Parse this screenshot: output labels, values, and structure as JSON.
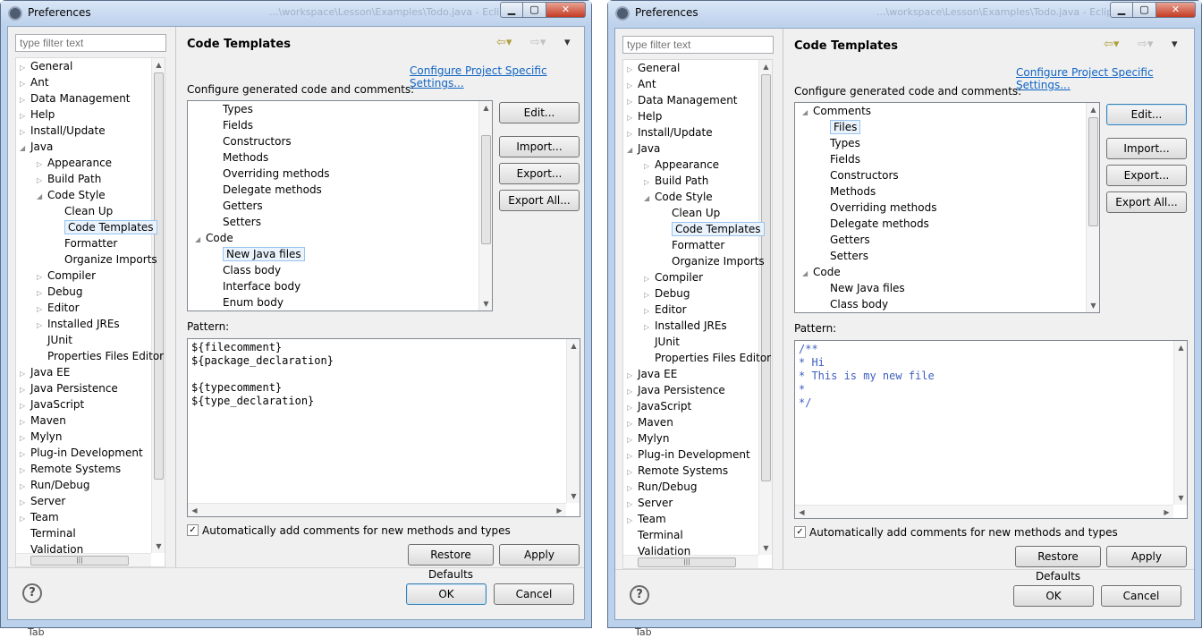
{
  "left": {
    "title": "Preferences",
    "ghost_title": "...\\workspace\\Lesson\\Examples\\Todo.java - Eclipse",
    "filter_placeholder": "type filter text",
    "tree": [
      {
        "label": "General",
        "level": 0,
        "exp": "closed"
      },
      {
        "label": "Ant",
        "level": 0,
        "exp": "closed"
      },
      {
        "label": "Data Management",
        "level": 0,
        "exp": "closed"
      },
      {
        "label": "Help",
        "level": 0,
        "exp": "closed"
      },
      {
        "label": "Install/Update",
        "level": 0,
        "exp": "closed"
      },
      {
        "label": "Java",
        "level": 0,
        "exp": "open"
      },
      {
        "label": "Appearance",
        "level": 1,
        "exp": "closed"
      },
      {
        "label": "Build Path",
        "level": 1,
        "exp": "closed"
      },
      {
        "label": "Code Style",
        "level": 1,
        "exp": "open"
      },
      {
        "label": "Clean Up",
        "level": 2,
        "exp": ""
      },
      {
        "label": "Code Templates",
        "level": 2,
        "exp": "",
        "selected": true
      },
      {
        "label": "Formatter",
        "level": 2,
        "exp": ""
      },
      {
        "label": "Organize Imports",
        "level": 2,
        "exp": ""
      },
      {
        "label": "Compiler",
        "level": 1,
        "exp": "closed"
      },
      {
        "label": "Debug",
        "level": 1,
        "exp": "closed"
      },
      {
        "label": "Editor",
        "level": 1,
        "exp": "closed"
      },
      {
        "label": "Installed JREs",
        "level": 1,
        "exp": "closed"
      },
      {
        "label": "JUnit",
        "level": 1,
        "exp": ""
      },
      {
        "label": "Properties Files Editor",
        "level": 1,
        "exp": ""
      },
      {
        "label": "Java EE",
        "level": 0,
        "exp": "closed"
      },
      {
        "label": "Java Persistence",
        "level": 0,
        "exp": "closed"
      },
      {
        "label": "JavaScript",
        "level": 0,
        "exp": "closed"
      },
      {
        "label": "Maven",
        "level": 0,
        "exp": "closed"
      },
      {
        "label": "Mylyn",
        "level": 0,
        "exp": "closed"
      },
      {
        "label": "Plug-in Development",
        "level": 0,
        "exp": "closed"
      },
      {
        "label": "Remote Systems",
        "level": 0,
        "exp": "closed"
      },
      {
        "label": "Run/Debug",
        "level": 0,
        "exp": "closed"
      },
      {
        "label": "Server",
        "level": 0,
        "exp": "closed"
      },
      {
        "label": "Team",
        "level": 0,
        "exp": "closed"
      },
      {
        "label": "Terminal",
        "level": 0,
        "exp": ""
      },
      {
        "label": "Validation",
        "level": 0,
        "exp": ""
      }
    ],
    "page_title": "Code Templates",
    "link": "Configure Project Specific Settings...",
    "description": "Configure generated code and comments:",
    "templates": [
      {
        "label": "Types",
        "level": 1
      },
      {
        "label": "Fields",
        "level": 1
      },
      {
        "label": "Constructors",
        "level": 1
      },
      {
        "label": "Methods",
        "level": 1
      },
      {
        "label": "Overriding methods",
        "level": 1
      },
      {
        "label": "Delegate methods",
        "level": 1
      },
      {
        "label": "Getters",
        "level": 1
      },
      {
        "label": "Setters",
        "level": 1
      },
      {
        "label": "Code",
        "level": 0,
        "exp": "open"
      },
      {
        "label": "New Java files",
        "level": 1,
        "selected": true
      },
      {
        "label": "Class body",
        "level": 1
      },
      {
        "label": "Interface body",
        "level": 1
      },
      {
        "label": "Enum body",
        "level": 1
      }
    ],
    "buttons": {
      "edit": "Edit...",
      "import": "Import...",
      "export": "Export...",
      "export_all": "Export All..."
    },
    "pattern_label": "Pattern:",
    "pattern": "${filecomment}\n${package_declaration}\n\n${typecomment}\n${type_declaration}",
    "auto_comments": "Automatically add comments for new methods and types",
    "restore": "Restore Defaults",
    "apply": "Apply",
    "ok": "OK",
    "cancel": "Cancel",
    "help": "?",
    "underneath": "Tab"
  },
  "right": {
    "title": "Preferences",
    "ghost_title": "...\\workspace\\Lesson\\Examples\\Todo.java - Eclipse",
    "filter_placeholder": "type filter text",
    "tree": [
      {
        "label": "General",
        "level": 0,
        "exp": "closed"
      },
      {
        "label": "Ant",
        "level": 0,
        "exp": "closed"
      },
      {
        "label": "Data Management",
        "level": 0,
        "exp": "closed"
      },
      {
        "label": "Help",
        "level": 0,
        "exp": "closed"
      },
      {
        "label": "Install/Update",
        "level": 0,
        "exp": "closed"
      },
      {
        "label": "Java",
        "level": 0,
        "exp": "open"
      },
      {
        "label": "Appearance",
        "level": 1,
        "exp": "closed"
      },
      {
        "label": "Build Path",
        "level": 1,
        "exp": "closed"
      },
      {
        "label": "Code Style",
        "level": 1,
        "exp": "open"
      },
      {
        "label": "Clean Up",
        "level": 2,
        "exp": ""
      },
      {
        "label": "Code Templates",
        "level": 2,
        "exp": "",
        "selected": true
      },
      {
        "label": "Formatter",
        "level": 2,
        "exp": ""
      },
      {
        "label": "Organize Imports",
        "level": 2,
        "exp": ""
      },
      {
        "label": "Compiler",
        "level": 1,
        "exp": "closed"
      },
      {
        "label": "Debug",
        "level": 1,
        "exp": "closed"
      },
      {
        "label": "Editor",
        "level": 1,
        "exp": "closed"
      },
      {
        "label": "Installed JREs",
        "level": 1,
        "exp": "closed"
      },
      {
        "label": "JUnit",
        "level": 1,
        "exp": ""
      },
      {
        "label": "Properties Files Editor",
        "level": 1,
        "exp": ""
      },
      {
        "label": "Java EE",
        "level": 0,
        "exp": "closed"
      },
      {
        "label": "Java Persistence",
        "level": 0,
        "exp": "closed"
      },
      {
        "label": "JavaScript",
        "level": 0,
        "exp": "closed"
      },
      {
        "label": "Maven",
        "level": 0,
        "exp": "closed"
      },
      {
        "label": "Mylyn",
        "level": 0,
        "exp": "closed"
      },
      {
        "label": "Plug-in Development",
        "level": 0,
        "exp": "closed"
      },
      {
        "label": "Remote Systems",
        "level": 0,
        "exp": "closed"
      },
      {
        "label": "Run/Debug",
        "level": 0,
        "exp": "closed"
      },
      {
        "label": "Server",
        "level": 0,
        "exp": "closed"
      },
      {
        "label": "Team",
        "level": 0,
        "exp": "closed"
      },
      {
        "label": "Terminal",
        "level": 0,
        "exp": ""
      },
      {
        "label": "Validation",
        "level": 0,
        "exp": ""
      }
    ],
    "page_title": "Code Templates",
    "link": "Configure Project Specific Settings...",
    "description": "Configure generated code and comments:",
    "templates": [
      {
        "label": "Comments",
        "level": 0,
        "exp": "open"
      },
      {
        "label": "Files",
        "level": 1,
        "selected": true
      },
      {
        "label": "Types",
        "level": 1
      },
      {
        "label": "Fields",
        "level": 1
      },
      {
        "label": "Constructors",
        "level": 1
      },
      {
        "label": "Methods",
        "level": 1
      },
      {
        "label": "Overriding methods",
        "level": 1
      },
      {
        "label": "Delegate methods",
        "level": 1
      },
      {
        "label": "Getters",
        "level": 1
      },
      {
        "label": "Setters",
        "level": 1
      },
      {
        "label": "Code",
        "level": 0,
        "exp": "open"
      },
      {
        "label": "New Java files",
        "level": 1
      },
      {
        "label": "Class body",
        "level": 1
      }
    ],
    "buttons": {
      "edit": "Edit...",
      "import": "Import...",
      "export": "Export...",
      "export_all": "Export All..."
    },
    "pattern_label": "Pattern:",
    "pattern": "/**\n* Hi\n* This is my new file\n*\n*/",
    "auto_comments": "Automatically add comments for new methods and types",
    "restore": "Restore Defaults",
    "apply": "Apply",
    "ok": "OK",
    "cancel": "Cancel",
    "help": "?",
    "underneath": "Tab"
  },
  "colors": {
    "link": "#0f64c4",
    "comment_code": "#3f5fbf",
    "selection_border": "#99c3ee"
  },
  "icons": [
    "eclipse-icon",
    "back-arrow-icon",
    "forward-arrow-icon",
    "menu-chevron-icon",
    "help-icon",
    "checkbox-checked-icon"
  ]
}
